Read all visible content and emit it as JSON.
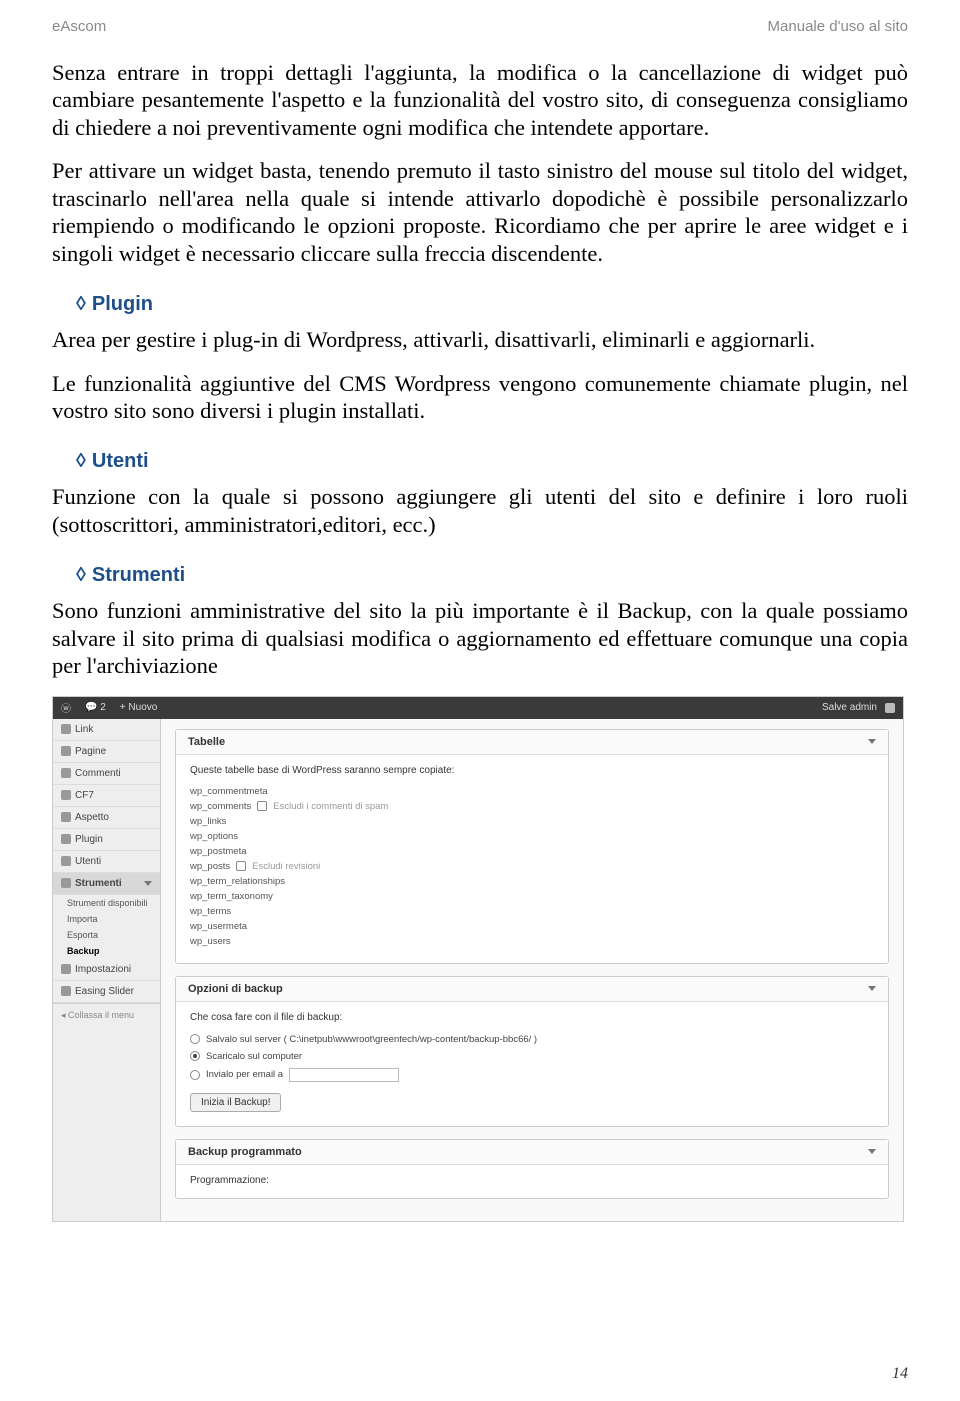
{
  "header": {
    "left": "eAscom",
    "right": "Manuale d'uso al sito"
  },
  "paragraphs": {
    "p1": "Senza entrare in troppi dettagli l'aggiunta, la modifica o la cancellazione di widget può cambiare pesantemente l'aspetto e la funzionalità del vostro sito, di conseguenza consigliamo di chiedere a noi preventivamente ogni modifica che intendete apportare.",
    "p2": "Per attivare un widget basta, tenendo premuto il tasto sinistro del mouse sul titolo del widget, trascinarlo nell'area nella quale si intende attivarlo dopodichè è possibile personalizzarlo riempiendo o modificando le opzioni proposte. Ricordiamo che per aprire le aree widget e i singoli widget è necessario cliccare sulla freccia discendente.",
    "p3": "Area per gestire i plug-in di Wordpress, attivarli, disattivarli, eliminarli e aggiornarli.",
    "p4": "Le funzionalità aggiuntive del CMS Wordpress vengono comunemente chiamate plugin, nel vostro sito sono diversi i plugin installati.",
    "p5": "Funzione con la quale si possono aggiungere gli utenti del sito e definire i loro ruoli (sottoscrittori, amministratori,editori, ecc.)",
    "p6": "Sono funzioni amministrative del sito la più importante è il Backup, con la quale possiamo salvare il sito prima di qualsiasi modifica o aggiornamento ed effettuare comunque una copia per l'archiviazione"
  },
  "sections": {
    "plugin": "Plugin",
    "utenti": "Utenti",
    "strumenti": "Strumenti"
  },
  "wp": {
    "topbar": {
      "comments": "2",
      "new": "+ Nuovo",
      "user": "Salve admin"
    },
    "sidebar": {
      "link": "Link",
      "pagine": "Pagine",
      "commenti": "Commenti",
      "cf7": "CF7",
      "aspetto": "Aspetto",
      "plugin": "Plugin",
      "utenti": "Utenti",
      "strumenti": "Strumenti",
      "sub1": "Strumenti disponibili",
      "sub2": "Importa",
      "sub3": "Esporta",
      "sub4": "Backup",
      "impostazioni": "Impostazioni",
      "easing": "Easing Slider",
      "collapse": "Collassa il menu"
    },
    "panel1": {
      "title": "Tabelle",
      "desc": "Queste tabelle base di WordPress saranno sempre copiate:",
      "t1": "wp_commentmeta",
      "t2": "wp_comments",
      "t2opt": "Escludi i commenti di spam",
      "t3": "wp_links",
      "t4": "wp_options",
      "t5": "wp_postmeta",
      "t6": "wp_posts",
      "t6opt": "Escludi revisioni",
      "t7": "wp_term_relationships",
      "t8": "wp_term_taxonomy",
      "t9": "wp_terms",
      "t10": "wp_usermeta",
      "t11": "wp_users"
    },
    "panel2": {
      "title": "Opzioni di backup",
      "desc": "Che cosa fare con il file di backup:",
      "r1": "Salvalo sul server ( C:\\inetpub\\wwwroot\\greentech/wp-content/backup-bbc66/ )",
      "r2": "Scaricalo sul computer",
      "r3": "Invialo per email a",
      "btn": "Inizia il Backup!"
    },
    "panel3": {
      "title": "Backup programmato",
      "label": "Programmazione:"
    }
  },
  "pageNumber": "14"
}
